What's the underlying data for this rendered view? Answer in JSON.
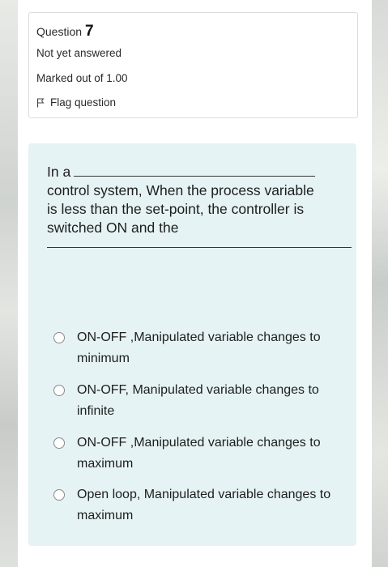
{
  "question_info": {
    "question_label": "Question",
    "question_number": "7",
    "state": "Not yet answered",
    "grade": "Marked out of 1.00",
    "flag_label": "Flag question"
  },
  "question": {
    "text_start": "In a",
    "text_middle": "control system, When the process variable is less than the set-point, the controller is switched ON and the"
  },
  "options": [
    {
      "label": "ON-OFF ,Manipulated variable changes to minimum"
    },
    {
      "label": "ON-OFF, Manipulated variable changes to infinite"
    },
    {
      "label": "ON-OFF ,Manipulated variable changes to maximum"
    },
    {
      "label": "Open loop, Manipulated variable changes to maximum"
    }
  ],
  "icons": {
    "flag": "flag-icon",
    "radio": "radio-unselected-icon"
  },
  "colors": {
    "content_background": "#e6f3f4",
    "info_border": "#dcdcdc"
  }
}
